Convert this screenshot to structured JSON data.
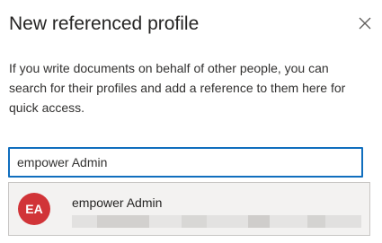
{
  "dialog": {
    "title": "New referenced profile",
    "close_icon": "close-icon",
    "description": "If you write documents on behalf of other people, you can search for their profiles and add a reference to them here for quick access."
  },
  "search": {
    "value": "empower Admin"
  },
  "suggestions": [
    {
      "initials": "EA",
      "name": "empower Admin",
      "avatar_color": "#d13438",
      "secondary_text_obscured": true
    }
  ],
  "colors": {
    "accent_border": "#106ebe",
    "suggestion_background": "#f3f2f1"
  }
}
